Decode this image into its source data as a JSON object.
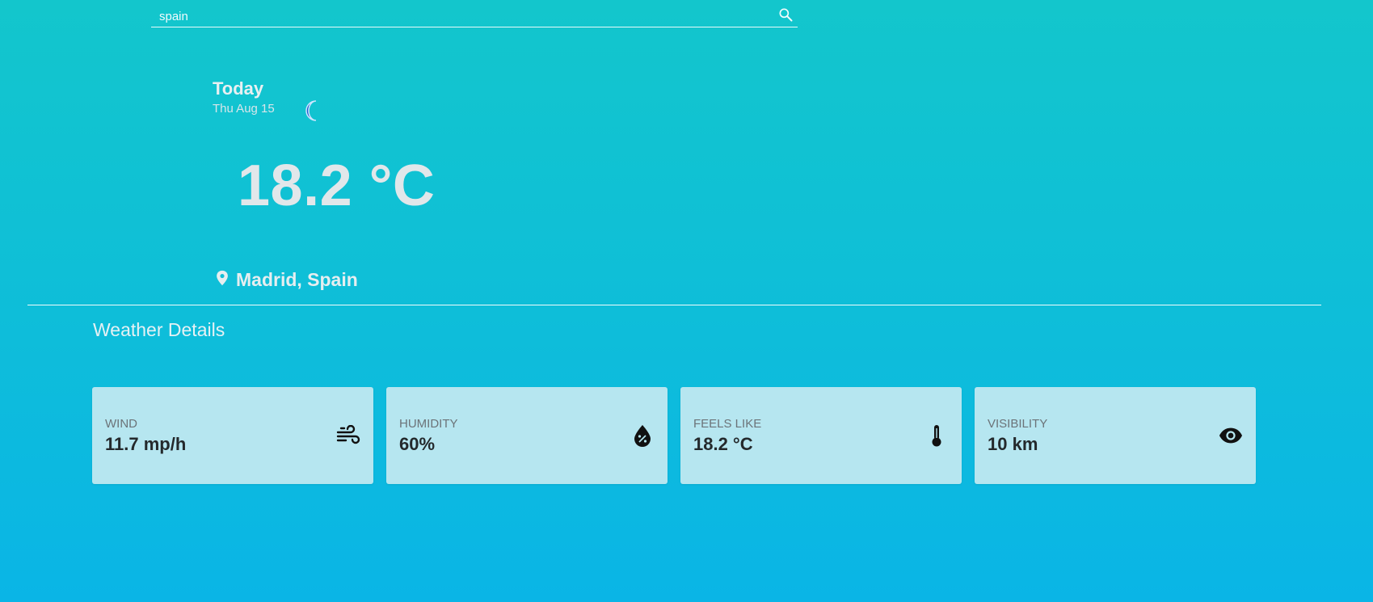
{
  "search": {
    "value": "spain",
    "icon": "search-icon"
  },
  "today": {
    "title": "Today",
    "date": "Thu Aug 15",
    "condition_icon": "moon-icon"
  },
  "current": {
    "temperature": "18.2 °C"
  },
  "location": {
    "icon": "location-pin-icon",
    "text": "Madrid, Spain"
  },
  "details": {
    "heading": "Weather Details",
    "cards": [
      {
        "label": "WIND",
        "value": "11.7 mp/h",
        "icon": "wind-icon"
      },
      {
        "label": "HUMIDITY",
        "value": "60%",
        "icon": "humidity-drop-icon"
      },
      {
        "label": "FEELS LIKE",
        "value": "18.2 °C",
        "icon": "thermometer-icon"
      },
      {
        "label": "VISIBILITY",
        "value": "10 km",
        "icon": "eye-icon"
      }
    ]
  },
  "colors": {
    "background_top": "#13c6cc",
    "background_bottom": "#0ab5e6",
    "card_background": "#b6e6f0",
    "moon": "#1f5fcf"
  }
}
